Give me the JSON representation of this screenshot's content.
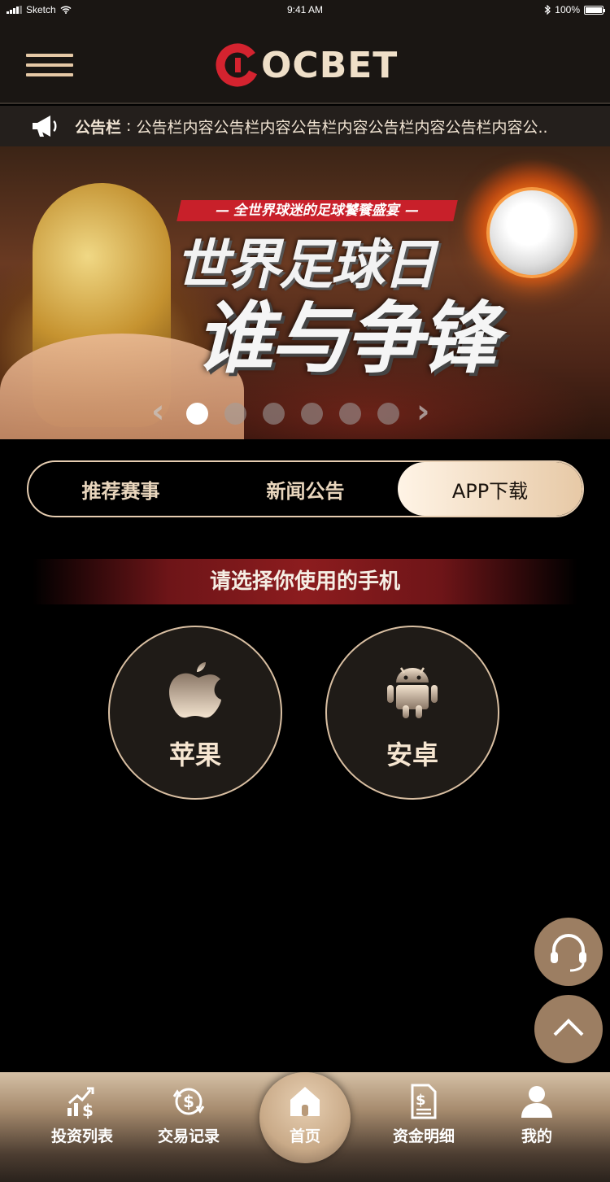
{
  "status_bar": {
    "carrier": "Sketch",
    "time": "9:41 AM",
    "battery": "100%"
  },
  "header": {
    "logo_text": "OCBET",
    "logo_color": "#d4232f"
  },
  "notice": {
    "label": "公告栏",
    "separator": " : ",
    "text": "公告栏内容公告栏内容公告栏内容公告栏内容公告栏内容公.."
  },
  "banner": {
    "ribbon": "— 全世界球迷的足球饕餮盛宴 —",
    "title_line1": "世界足球日",
    "title_line2": "谁与争锋",
    "slide_count": 6,
    "active_slide": 1
  },
  "tabs": [
    {
      "label": "推荐赛事",
      "active": false
    },
    {
      "label": "新闻公告",
      "active": false
    },
    {
      "label": "APP下载",
      "active": true
    }
  ],
  "download": {
    "heading": "请选择你使用的手机",
    "apple_label": "苹果",
    "android_label": "安卓"
  },
  "bottom_nav": [
    {
      "label": "投资列表",
      "icon": "chart-dollar-icon"
    },
    {
      "label": "交易记录",
      "icon": "exchange-dollar-icon"
    },
    {
      "label": "首页",
      "icon": "home-icon"
    },
    {
      "label": "资金明细",
      "icon": "document-dollar-icon"
    },
    {
      "label": "我的",
      "icon": "user-icon"
    }
  ],
  "colors": {
    "accent_gold": "#e6cdb1",
    "accent_red": "#8c1c1e",
    "background": "#000000"
  }
}
